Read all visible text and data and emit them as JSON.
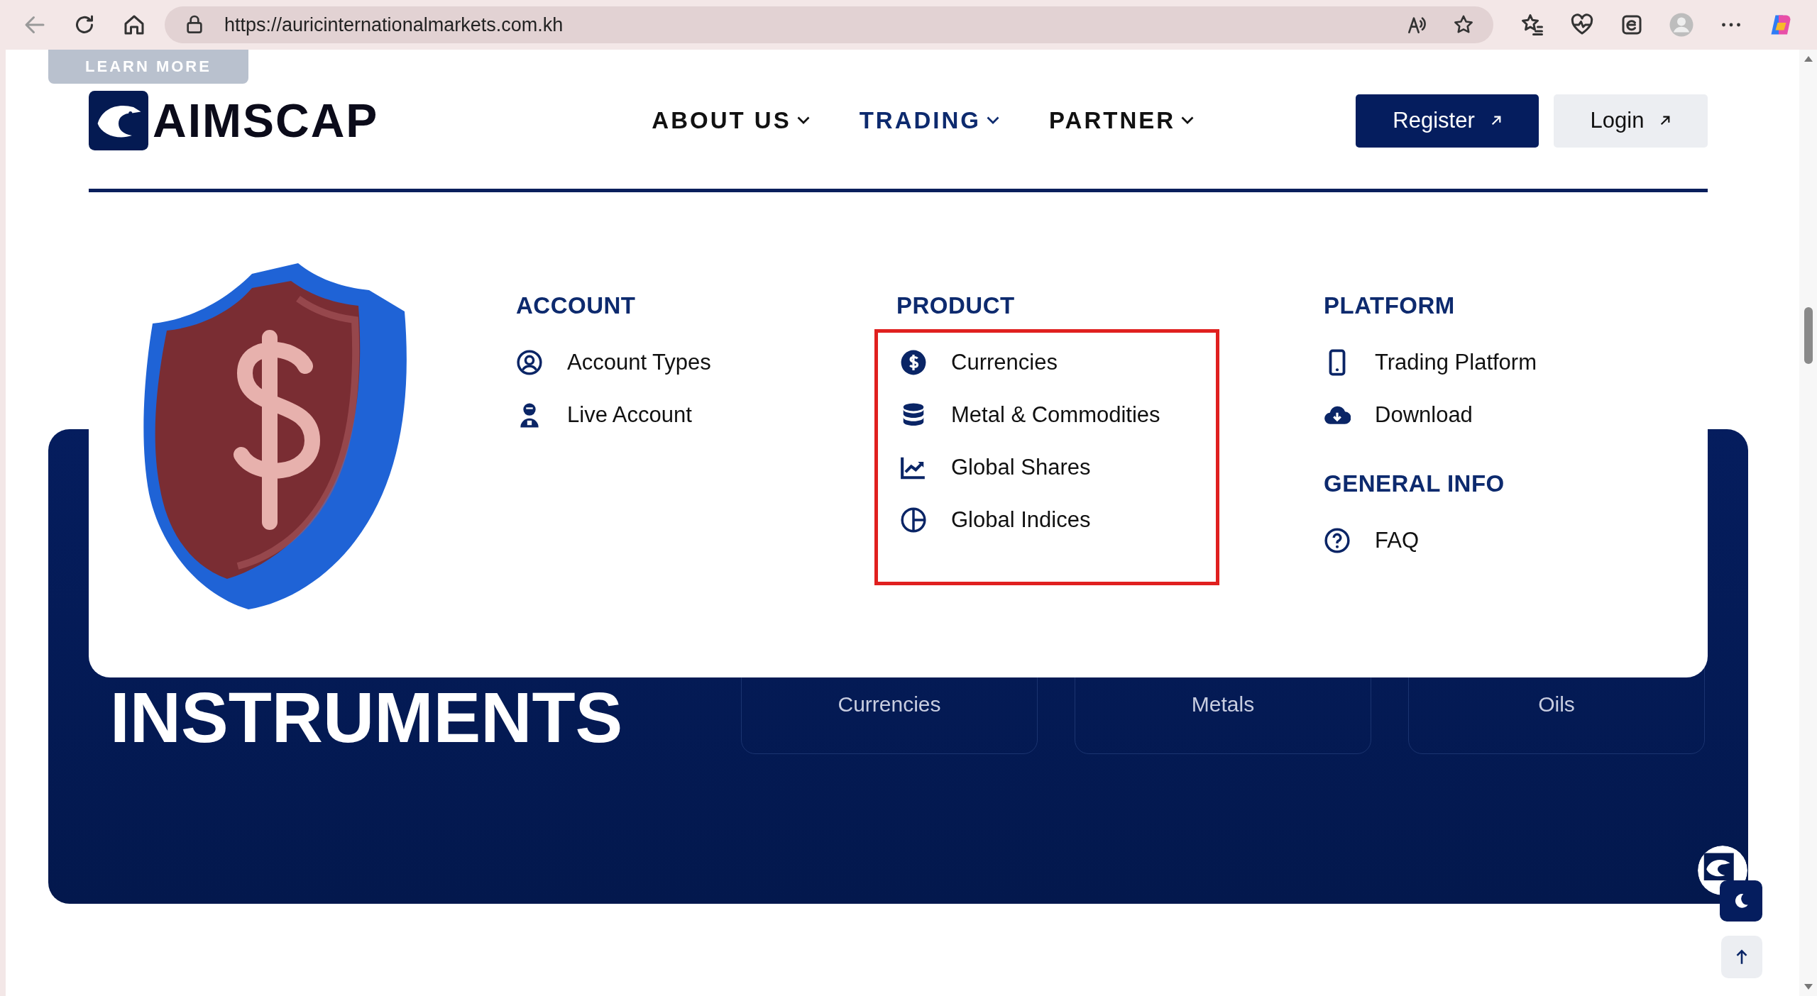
{
  "browser": {
    "url": "https://auricinternationalmarkets.com.kh"
  },
  "learn_more_button": {
    "label": "LEARN MORE"
  },
  "header": {
    "logo_text": "AIMSCAP",
    "nav": [
      {
        "label": "ABOUT US",
        "selected": false
      },
      {
        "label": "TRADING",
        "selected": true
      },
      {
        "label": "PARTNER",
        "selected": false
      }
    ],
    "buttons": [
      {
        "label": "Register",
        "kind": "primary"
      },
      {
        "label": "Login",
        "kind": "secondary"
      }
    ]
  },
  "dropdown": {
    "columns": [
      {
        "sections": [
          {
            "heading": "ACCOUNT",
            "highlighted": false,
            "items": [
              {
                "label": "Account Types"
              },
              {
                "label": "Live Account"
              }
            ]
          }
        ]
      },
      {
        "sections": [
          {
            "heading": "PRODUCT",
            "highlighted": true,
            "items": [
              {
                "label": "Currencies"
              },
              {
                "label": "Metal & Commodities"
              },
              {
                "label": "Global Shares"
              },
              {
                "label": "Global Indices"
              }
            ]
          }
        ]
      },
      {
        "sections": [
          {
            "heading": "PLATFORM",
            "highlighted": false,
            "items": [
              {
                "label": "Trading Platform"
              },
              {
                "label": "Download"
              }
            ]
          },
          {
            "heading": "GENERAL INFO",
            "highlighted": false,
            "items": [
              {
                "label": "FAQ"
              }
            ]
          }
        ]
      }
    ]
  },
  "hero": {
    "title_lines": [
      "INSTRUMENTS"
    ],
    "tabs": [
      {
        "label": "Currencies"
      },
      {
        "label": "Metals"
      },
      {
        "label": "Oils"
      }
    ]
  }
}
